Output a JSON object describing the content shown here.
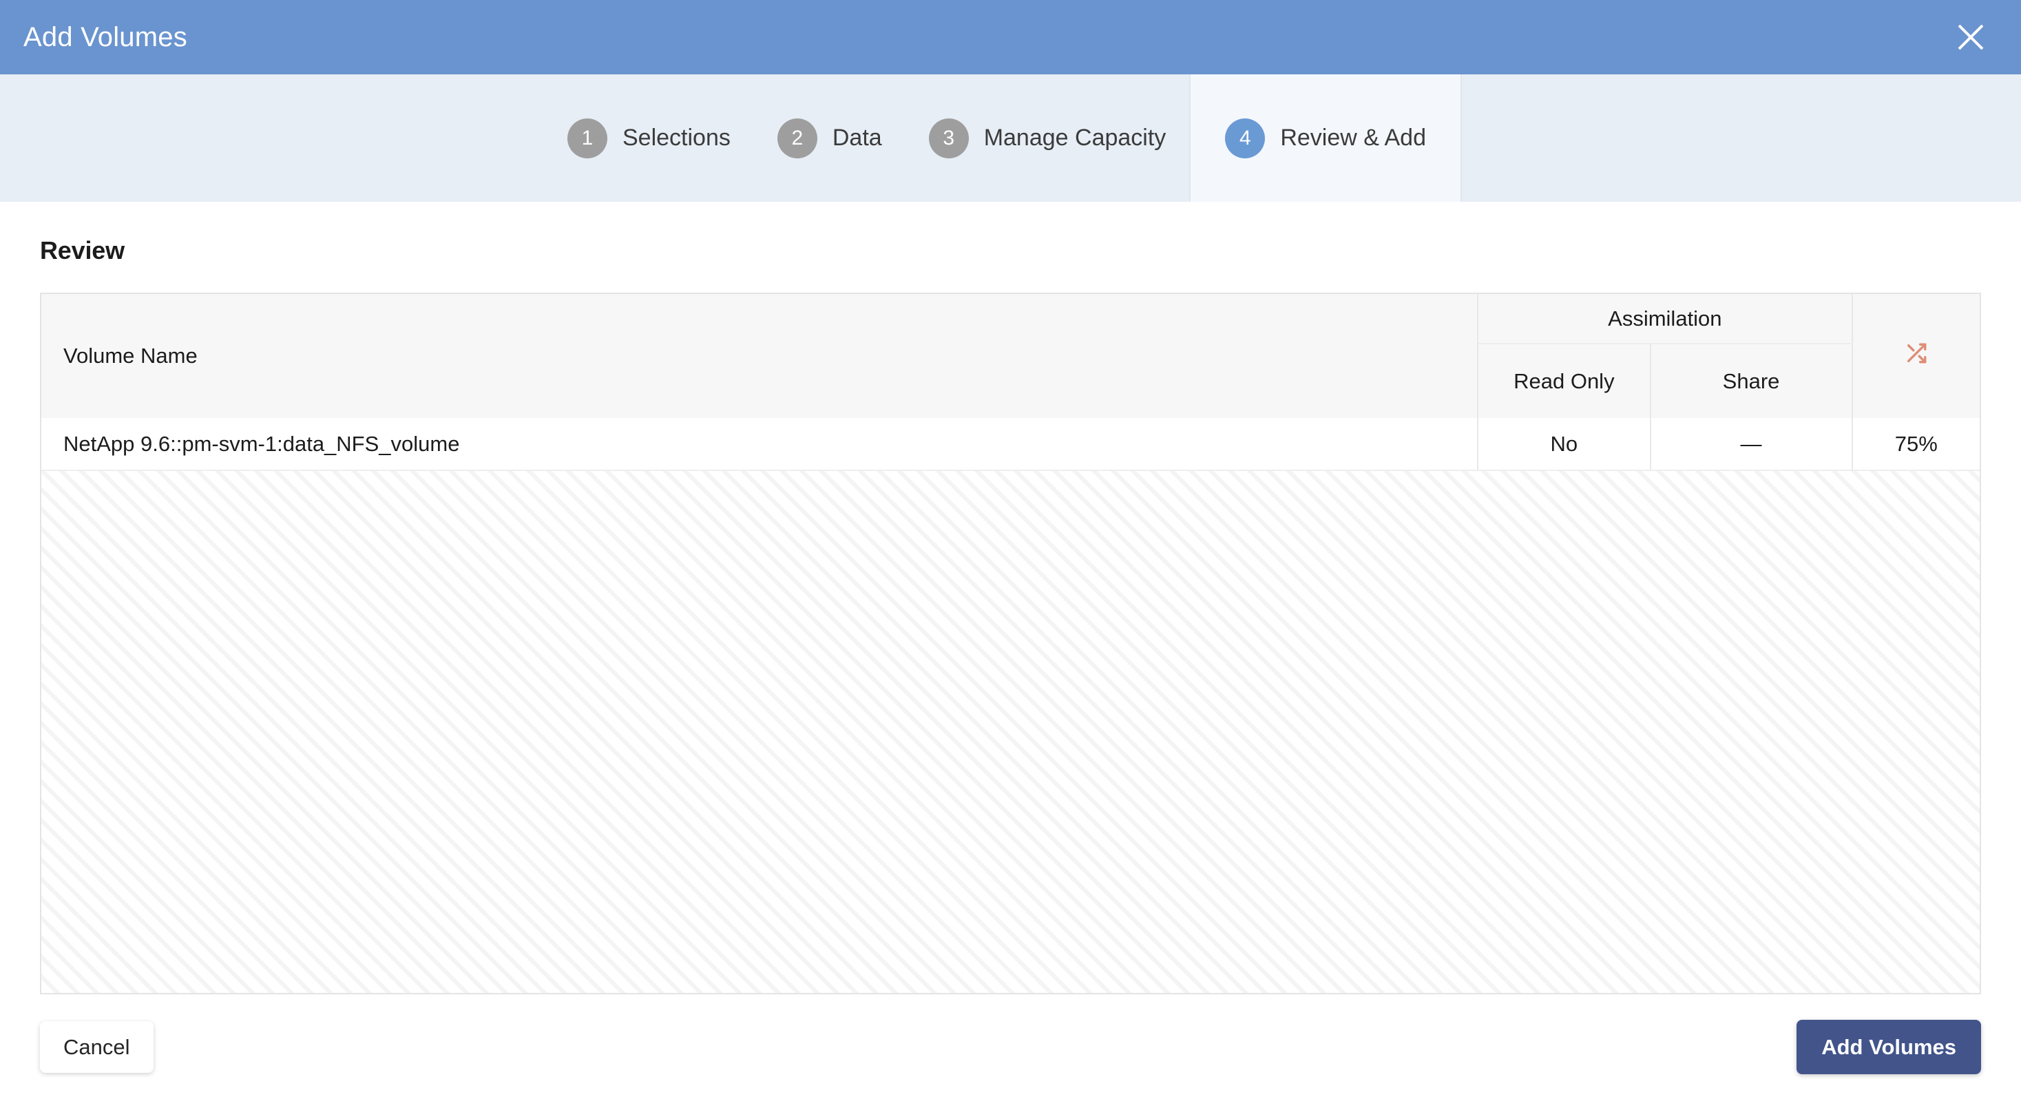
{
  "dialog": {
    "title": "Add Volumes",
    "close_icon": "close-icon"
  },
  "steps": [
    {
      "number": "1",
      "label": "Selections",
      "active": false
    },
    {
      "number": "2",
      "label": "Data",
      "active": false
    },
    {
      "number": "3",
      "label": "Manage Capacity",
      "active": false
    },
    {
      "number": "4",
      "label": "Review & Add",
      "active": true
    }
  ],
  "main": {
    "section_title": "Review",
    "table": {
      "columns": {
        "volume_name": "Volume Name",
        "group_header": "Assimilation",
        "read_only": "Read Only",
        "share": "Share",
        "shuffle_icon": "shuffle-icon"
      },
      "rows": [
        {
          "volume_name": "NetApp 9.6::pm-svm-1:data_NFS_volume",
          "read_only": "No",
          "share": "—",
          "percent": "75%"
        }
      ]
    }
  },
  "footer": {
    "cancel_label": "Cancel",
    "submit_label": "Add Volumes"
  },
  "colors": {
    "titlebar": "#6a94cf",
    "steps_bg": "#e7eef6",
    "active_step_bg": "#f4f8fc",
    "active_circle": "#6a9ad4",
    "inactive_circle": "#9e9e9e",
    "primary_button": "#42548a",
    "shuffle_icon": "#dd8e75",
    "table_header_bg": "#f7f7f7"
  }
}
